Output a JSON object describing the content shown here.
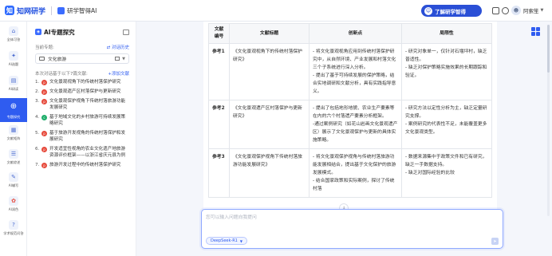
{
  "header": {
    "logo_text": "知网研学",
    "product_name": "研学智得AI",
    "promo_label": "了解研学智得",
    "user_name": "阿索笙"
  },
  "rail": {
    "items": [
      {
        "label": "全体可答",
        "icon": "home-icon"
      },
      {
        "label": "AI选题",
        "icon": "topic-icon"
      },
      {
        "label": "AI研读",
        "icon": "read-icon"
      },
      {
        "label": "专题探究",
        "icon": "explore-icon"
      },
      {
        "label": "文献矩阵",
        "icon": "matrix-icon"
      },
      {
        "label": "文献综述",
        "icon": "review-icon"
      },
      {
        "label": "AI辅写",
        "icon": "write-icon"
      },
      {
        "label": "AI润色",
        "icon": "polish-icon"
      },
      {
        "label": "学术规范问答",
        "icon": "qa-icon"
      }
    ]
  },
  "panel": {
    "title": "AI专题探究",
    "current_label": "当前专题:",
    "history_link": "对话历史",
    "selected_topic": "文化旅游",
    "docs_label": "本次对话基于以下7篇文献:",
    "add_docs": "+添加文献",
    "docs": [
      {
        "num": "1.",
        "type": "pdf",
        "title": "文化景观视角下的传统村落保护研究"
      },
      {
        "num": "2.",
        "type": "pdf",
        "title": "文化景观遗产区村落保护与更新研究"
      },
      {
        "num": "3.",
        "type": "pdf",
        "title": "文化景观保护视角下传统村落旅游功能发展研究"
      },
      {
        "num": "4.",
        "type": "caj",
        "title": "基于地域文化的乡村旅游可持续发展策略研究"
      },
      {
        "num": "5.",
        "type": "pdf",
        "title": "基于旅游开发视角的传统村落保护和发展研究"
      },
      {
        "num": "6.",
        "type": "pdf",
        "title": "开发适宜性视角的农业文化遗产地旅游资源评价框架——以浙江省庆元县为例"
      },
      {
        "num": "7.",
        "type": "pdf",
        "title": "旅游开发过程中的传统村落保护研究"
      }
    ]
  },
  "table": {
    "headers": [
      "文献编号",
      "文献标题",
      "创新点",
      "局限性"
    ],
    "rows": [
      {
        "ref": "参考1",
        "title": "《文化景观视角下的传统村落保护研究》",
        "innovations": [
          "- 将文化景观视角应用到传统村落保护研究中，从自然环境、产业发展和村落文化三个子系统进行深入分析。",
          "- 提出了基于可持续发展的保护策略，结合实地调研和文献分析，具有实践指导意义。"
        ],
        "limitations": [
          "- 研究对象单一，仅针对石堰坪村，缺乏普适性。",
          "- 缺乏对保护策略实施效果的长期跟踪和验证。"
        ]
      },
      {
        "ref": "参考2",
        "title": "《文化景观遗产区村落保护与更新研究》",
        "innovations": [
          "- 提出了包括地形地貌、农业生产要素等在内的六个村落遗产要素分析框架。",
          "-通过案例研究（如花山岩画文化景观遗产区）展示了文化景观保护与更新的具体实施策略。"
        ],
        "limitations": [
          "- 研究方法以定性分析为主，缺乏定量研究支撑。",
          "- 案例研究的代表性不足，未能覆盖更多文化景观类型。"
        ]
      },
      {
        "ref": "参考3",
        "title": "《文化景观保护视角下传统村落旅游功能发展研究》",
        "innovations": [
          "- 将文化景观保护视角与传统村落旅游功能发展相结合，提出基于文化保护的旅游发展模式。",
          "- 结合国家政策和实际案例，探讨了传统村落"
        ],
        "limitations": [
          "- 数据来源集中于政策文件和已有研究，缺乏一手数据支持。",
          "- 缺乏对国际经验的比较"
        ]
      }
    ]
  },
  "input": {
    "placeholder": "您可以输入问题向我提问",
    "model": "DeepSeek-R1"
  },
  "colors": {
    "accent": "#2f5cf0",
    "pdf_icon": "#e64a3c",
    "caj_icon": "#1fae6b"
  }
}
